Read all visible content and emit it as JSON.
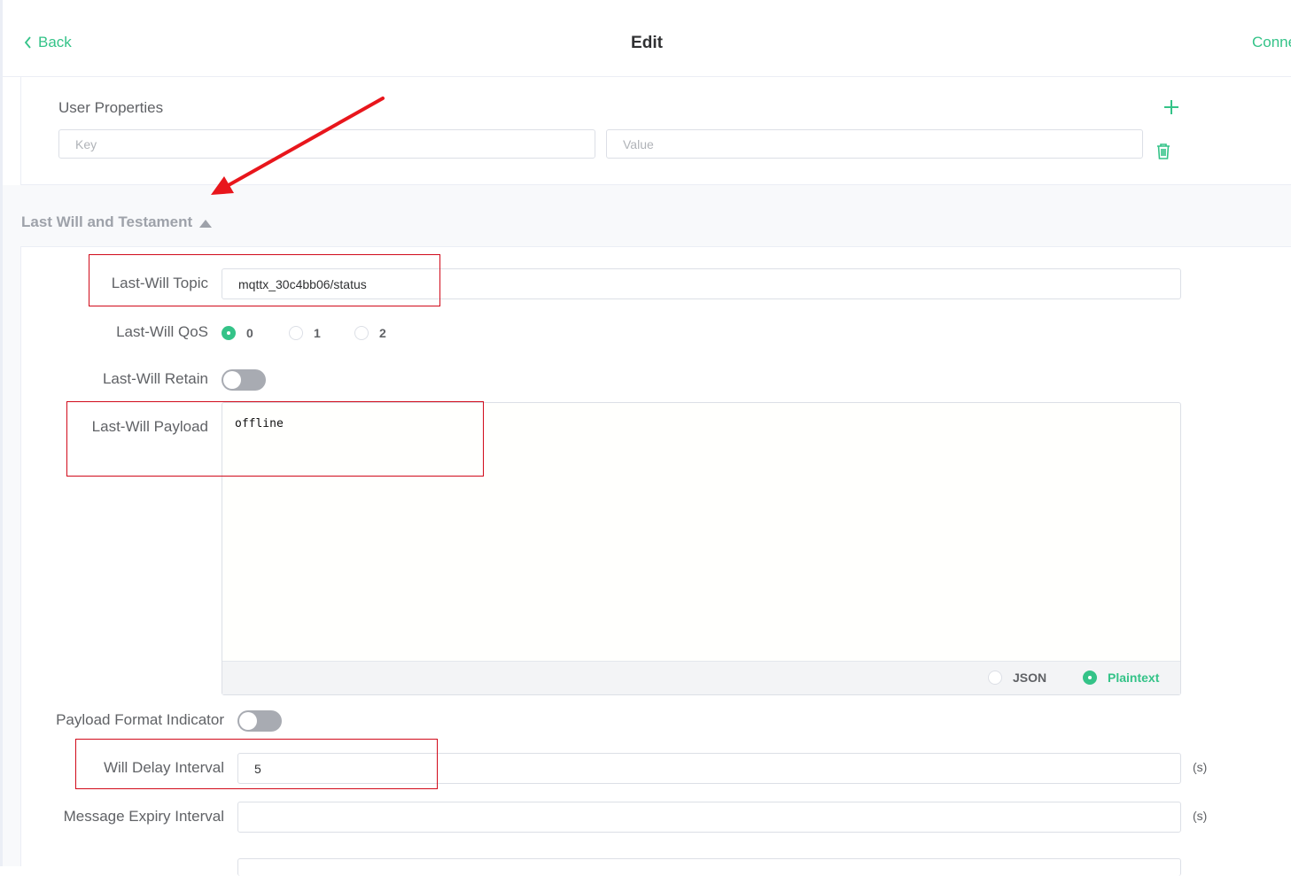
{
  "header": {
    "back_label": "Back",
    "title": "Edit",
    "connect_label": "Conne"
  },
  "user_properties": {
    "label": "User Properties",
    "key_placeholder": "Key",
    "value_placeholder": "Value"
  },
  "lwt": {
    "section_title": "Last Will and Testament",
    "topic_label": "Last-Will Topic",
    "topic_value": "mqttx_30c4bb06/status",
    "qos_label": "Last-Will QoS",
    "qos_options": [
      "0",
      "1",
      "2"
    ],
    "qos_selected": "0",
    "retain_label": "Last-Will Retain",
    "retain_on": false,
    "payload_label": "Last-Will Payload",
    "payload_value": "offline",
    "payload_formats": [
      "JSON",
      "Plaintext"
    ],
    "payload_format_selected": "Plaintext",
    "pfi_label": "Payload Format Indicator",
    "pfi_on": false,
    "will_delay_label": "Will Delay Interval",
    "will_delay_value": "5",
    "will_delay_unit": "(s)",
    "message_expiry_label": "Message Expiry Interval",
    "message_expiry_value": "",
    "message_expiry_unit": "(s)"
  },
  "colors": {
    "accent": "#34c388",
    "annotation": "#d10a1a",
    "arrow": "#e8161c"
  }
}
